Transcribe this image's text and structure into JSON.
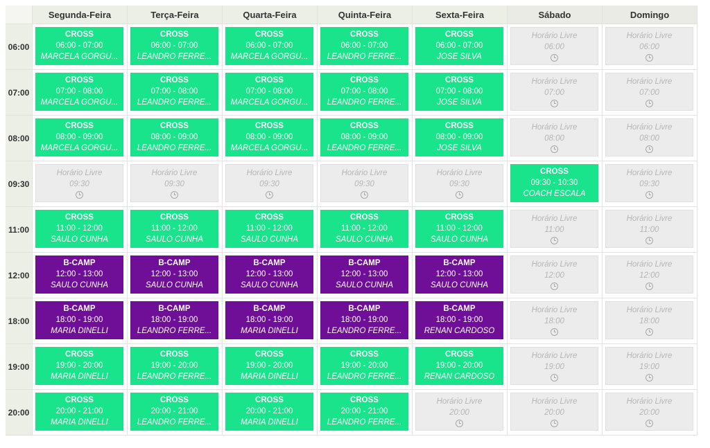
{
  "days": [
    "Segunda-Feira",
    "Terça-Feira",
    "Quarta-Feira",
    "Quinta-Feira",
    "Sexta-Feira",
    "Sábado",
    "Domingo"
  ],
  "free_label": "Horário Livre",
  "colors": {
    "cross": "#19e38b",
    "bcamp": "#6f0e96",
    "free": "#ececec",
    "header": "#ecefe6"
  },
  "rows": [
    {
      "time": "06:00",
      "cells": [
        {
          "type": "cross",
          "title": "CROSS",
          "hours": "06:00 - 07:00",
          "name": "MARCELA GORGU..."
        },
        {
          "type": "cross",
          "title": "CROSS",
          "hours": "06:00 - 07:00",
          "name": "LEANDRO FERRE..."
        },
        {
          "type": "cross",
          "title": "CROSS",
          "hours": "06:00 - 07:00",
          "name": "MARCELA GORGU..."
        },
        {
          "type": "cross",
          "title": "CROSS",
          "hours": "06:00 - 07:00",
          "name": "LEANDRO FERRE..."
        },
        {
          "type": "cross",
          "title": "CROSS",
          "hours": "06:00 - 07:00",
          "name": "JOSE SILVA"
        },
        {
          "type": "free",
          "hours": "06:00"
        },
        {
          "type": "free",
          "hours": "06:00"
        }
      ]
    },
    {
      "time": "07:00",
      "cells": [
        {
          "type": "cross",
          "title": "CROSS",
          "hours": "07:00 - 08:00",
          "name": "MARCELA GORGU..."
        },
        {
          "type": "cross",
          "title": "CROSS",
          "hours": "07:00 - 08:00",
          "name": "LEANDRO FERRE..."
        },
        {
          "type": "cross",
          "title": "CROSS",
          "hours": "07:00 - 08:00",
          "name": "MARCELA GORGU..."
        },
        {
          "type": "cross",
          "title": "CROSS",
          "hours": "07:00 - 08:00",
          "name": "LEANDRO FERRE..."
        },
        {
          "type": "cross",
          "title": "CROSS",
          "hours": "07:00 - 08:00",
          "name": "JOSE SILVA"
        },
        {
          "type": "free",
          "hours": "07:00"
        },
        {
          "type": "free",
          "hours": "07:00"
        }
      ]
    },
    {
      "time": "08:00",
      "cells": [
        {
          "type": "cross",
          "title": "CROSS",
          "hours": "08:00 - 09:00",
          "name": "MARCELA GORGU..."
        },
        {
          "type": "cross",
          "title": "CROSS",
          "hours": "08:00 - 09:00",
          "name": "LEANDRO FERRE..."
        },
        {
          "type": "cross",
          "title": "CROSS",
          "hours": "08:00 - 09:00",
          "name": "MARCELA GORGU..."
        },
        {
          "type": "cross",
          "title": "CROSS",
          "hours": "08:00 - 09:00",
          "name": "LEANDRO FERRE..."
        },
        {
          "type": "cross",
          "title": "CROSS",
          "hours": "08:00 - 09:00",
          "name": "JOSE SILVA"
        },
        {
          "type": "free",
          "hours": "08:00"
        },
        {
          "type": "free",
          "hours": "08:00"
        }
      ]
    },
    {
      "time": "09:30",
      "cells": [
        {
          "type": "free",
          "hours": "09:30"
        },
        {
          "type": "free",
          "hours": "09:30"
        },
        {
          "type": "free",
          "hours": "09:30"
        },
        {
          "type": "free",
          "hours": "09:30"
        },
        {
          "type": "free",
          "hours": "09:30"
        },
        {
          "type": "cross",
          "title": "CROSS",
          "hours": "09:30 - 10:30",
          "name": "COACH ESCALA"
        },
        {
          "type": "free",
          "hours": "09:30"
        }
      ]
    },
    {
      "time": "11:00",
      "cells": [
        {
          "type": "cross",
          "title": "CROSS",
          "hours": "11:00 - 12:00",
          "name": "SAULO CUNHA"
        },
        {
          "type": "cross",
          "title": "CROSS",
          "hours": "11:00 - 12:00",
          "name": "SAULO CUNHA"
        },
        {
          "type": "cross",
          "title": "CROSS",
          "hours": "11:00 - 12:00",
          "name": "SAULO CUNHA"
        },
        {
          "type": "cross",
          "title": "CROSS",
          "hours": "11:00 - 12:00",
          "name": "SAULO CUNHA"
        },
        {
          "type": "cross",
          "title": "CROSS",
          "hours": "11:00 - 12:00",
          "name": "SAULO CUNHA"
        },
        {
          "type": "free",
          "hours": "11:00"
        },
        {
          "type": "free",
          "hours": "11:00"
        }
      ]
    },
    {
      "time": "12:00",
      "cells": [
        {
          "type": "bcamp",
          "title": "B-CAMP",
          "hours": "12:00 - 13:00",
          "name": "SAULO CUNHA"
        },
        {
          "type": "bcamp",
          "title": "B-CAMP",
          "hours": "12:00 - 13:00",
          "name": "SAULO CUNHA"
        },
        {
          "type": "bcamp",
          "title": "B-CAMP",
          "hours": "12:00 - 13:00",
          "name": "SAULO CUNHA"
        },
        {
          "type": "bcamp",
          "title": "B-CAMP",
          "hours": "12:00 - 13:00",
          "name": "SAULO CUNHA"
        },
        {
          "type": "bcamp",
          "title": "B-CAMP",
          "hours": "12:00 - 13:00",
          "name": "SAULO CUNHA"
        },
        {
          "type": "free",
          "hours": "12:00"
        },
        {
          "type": "free",
          "hours": "12:00"
        }
      ]
    },
    {
      "time": "18:00",
      "cells": [
        {
          "type": "bcamp",
          "title": "B-CAMP",
          "hours": "18:00 - 19:00",
          "name": "MARIA DINELLI"
        },
        {
          "type": "bcamp",
          "title": "B-CAMP",
          "hours": "18:00 - 19:00",
          "name": "LEANDRO FERRE..."
        },
        {
          "type": "bcamp",
          "title": "B-CAMP",
          "hours": "18:00 - 19:00",
          "name": "MARIA DINELLI"
        },
        {
          "type": "bcamp",
          "title": "B-CAMP",
          "hours": "18:00 - 19:00",
          "name": "LEANDRO FERRE..."
        },
        {
          "type": "bcamp",
          "title": "B-CAMP",
          "hours": "18:00 - 19:00",
          "name": "RENAN CARDOSO"
        },
        {
          "type": "free",
          "hours": "18:00"
        },
        {
          "type": "free",
          "hours": "18:00"
        }
      ]
    },
    {
      "time": "19:00",
      "cells": [
        {
          "type": "cross",
          "title": "CROSS",
          "hours": "19:00 - 20:00",
          "name": "MARIA DINELLI"
        },
        {
          "type": "cross",
          "title": "CROSS",
          "hours": "19:00 - 20:00",
          "name": "LEANDRO FERRE..."
        },
        {
          "type": "cross",
          "title": "CROSS",
          "hours": "19:00 - 20:00",
          "name": "MARIA DINELLI"
        },
        {
          "type": "cross",
          "title": "CROSS",
          "hours": "19:00 - 20:00",
          "name": "LEANDRO FERRE..."
        },
        {
          "type": "cross",
          "title": "CROSS",
          "hours": "19:00 - 20:00",
          "name": "RENAN CARDOSO"
        },
        {
          "type": "free",
          "hours": "19:00"
        },
        {
          "type": "free",
          "hours": "19:00"
        }
      ]
    },
    {
      "time": "20:00",
      "cells": [
        {
          "type": "cross",
          "title": "CROSS",
          "hours": "20:00 - 21:00",
          "name": "MARIA DINELLI"
        },
        {
          "type": "cross",
          "title": "CROSS",
          "hours": "20:00 - 21:00",
          "name": "LEANDRO FERRE..."
        },
        {
          "type": "cross",
          "title": "CROSS",
          "hours": "20:00 - 21:00",
          "name": "MARIA DINELLI"
        },
        {
          "type": "cross",
          "title": "CROSS",
          "hours": "20:00 - 21:00",
          "name": "LEANDRO FERRE..."
        },
        {
          "type": "free",
          "hours": "20:00"
        },
        {
          "type": "free",
          "hours": "20:00"
        },
        {
          "type": "free",
          "hours": "20:00"
        }
      ]
    }
  ]
}
